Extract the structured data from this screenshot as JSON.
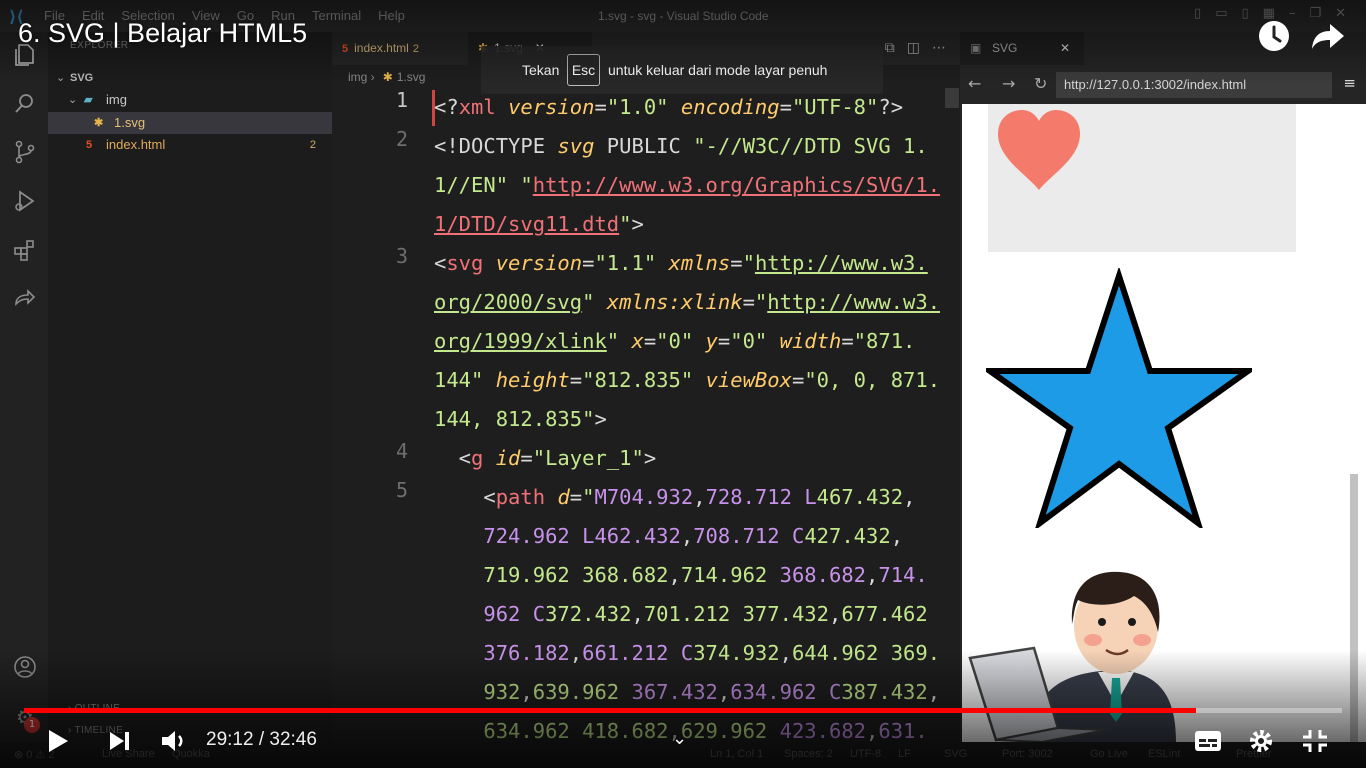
{
  "colors": {
    "progress": "#ff0000",
    "editor_bg": "#1e1e1e",
    "star": "#1e9be6",
    "heart": "#f47b6b"
  },
  "vscode": {
    "menu": [
      "File",
      "Edit",
      "Selection",
      "View",
      "Go",
      "Run",
      "Terminal",
      "Help"
    ],
    "window_title": "1.svg - svg - Visual Studio Code",
    "explorer": {
      "header": "EXPLORER",
      "root": "SVG",
      "folder": "img",
      "file_selected": "1.svg",
      "file_html": "index.html",
      "file_html_problems": "2",
      "outline": "OUTLINE",
      "timeline": "TIMELINE"
    },
    "tabs": [
      {
        "label": "index.html",
        "problems": "2"
      },
      {
        "label": "1.svg"
      }
    ],
    "breadcrumb": {
      "folder": "img",
      "file": "1.svg"
    },
    "line_numbers": [
      "1",
      "2",
      "3",
      "4",
      "5"
    ],
    "status_bar": {
      "problems": "⊗ 0 ⚠ 2",
      "live_share": "Live Share",
      "quokka": "Quokka",
      "position": "Ln 1, Col 1",
      "spaces": "Spaces: 2",
      "encoding": "UTF-8",
      "eol": "LF",
      "language": "SVG",
      "port": "Port: 3002",
      "go_live": "Go Live",
      "eslint": "ESLint",
      "prettier": "Prettier"
    },
    "activity_badge": "1"
  },
  "code": {
    "l1": [
      "<?",
      "xml",
      " ",
      "version",
      "=",
      "\"1.0\"",
      " ",
      "encoding",
      "=",
      "\"UTF-8\"",
      "?>"
    ],
    "l2a": [
      "<!DOCTYPE ",
      "svg",
      " PUBLIC ",
      "\"-//W3C//DTD SVG 1."
    ],
    "l2b": [
      "1//EN\"",
      " ",
      "\"",
      "http://www.w3.org/Graphics/SVG/1."
    ],
    "l2c": [
      "1/DTD/svg11.dtd",
      "\"",
      ">"
    ],
    "l3a": [
      "<",
      "svg",
      " ",
      "version",
      "=",
      "\"1.1\"",
      " ",
      "xmlns",
      "=",
      "\"",
      "http://www.w3."
    ],
    "l3b": [
      "org/2000/svg",
      "\"",
      " ",
      "xmlns:xlink",
      "=",
      "\"",
      "http://www.w3."
    ],
    "l3c": [
      "org/1999/xlink",
      "\"",
      " ",
      "x",
      "=",
      "\"0\"",
      " ",
      "y",
      "=",
      "\"0\"",
      " ",
      "width",
      "=",
      "\"871."
    ],
    "l3d": [
      "144\"",
      " ",
      "height",
      "=",
      "\"812.835\"",
      " ",
      "viewBox",
      "=",
      "\"0, 0, 871."
    ],
    "l3e": [
      "144, 812.835\"",
      ">"
    ],
    "l4": [
      "  <",
      "g",
      " ",
      "id",
      "=",
      "\"Layer_1\"",
      ">"
    ],
    "l5a": [
      "    <",
      "path",
      " ",
      "d",
      "=",
      "\"",
      "M",
      "704.932",
      ",",
      "728.712",
      " ",
      "L",
      "467.432",
      ","
    ],
    "l5b": [
      "    ",
      "724.962",
      " ",
      "L",
      "462.432",
      ",",
      "708.712",
      " ",
      "C",
      "427.432",
      ","
    ],
    "l5c": [
      "    ",
      "719.962 368.682",
      ",",
      "714.962",
      " ",
      "368.682",
      ",",
      "714."
    ],
    "l5d": [
      "    ",
      "962",
      " ",
      "C",
      "372.432",
      ",",
      "701.212",
      " ",
      "377.432",
      ",",
      "677.462"
    ],
    "l5e": [
      "    ",
      "376.182",
      ",",
      "661.212",
      " ",
      "C",
      "374.932",
      ",",
      "644.962",
      " ",
      "369."
    ],
    "l5f": [
      "    ",
      "932",
      ",",
      "639.962",
      " ",
      "367.432",
      ",",
      "634.962",
      " ",
      "C",
      "387.432",
      ","
    ],
    "l5g": [
      "    ",
      "634.962",
      " ",
      "418.682",
      ",",
      "629.962",
      " ",
      "423.682",
      ",",
      "631."
    ]
  },
  "toast": {
    "before": "Tekan",
    "key": "Esc",
    "after": "untuk keluar dari mode layar penuh"
  },
  "browser": {
    "tab_label": "SVG",
    "url": "http://127.0.0.1:3002/index.html"
  },
  "youtube": {
    "title": "6. SVG | Belajar HTML5",
    "current_time": "29:12",
    "duration": "32:46",
    "time_display": "29:12 / 32:46",
    "progress_fraction": 0.889
  }
}
